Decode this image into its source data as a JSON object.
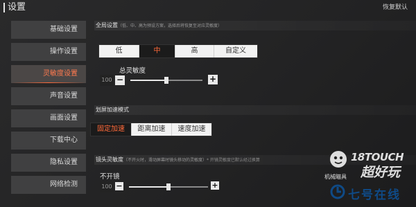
{
  "header": {
    "title": "设置",
    "restore_label": "恢复默认"
  },
  "sidebar": {
    "items": [
      {
        "label": "基础设置"
      },
      {
        "label": "操作设置"
      },
      {
        "label": "灵敏度设置"
      },
      {
        "label": "声音设置"
      },
      {
        "label": "画面设置"
      },
      {
        "label": "下载中心"
      },
      {
        "label": "隐私设置"
      },
      {
        "label": "网络检测"
      }
    ],
    "active_index": 2
  },
  "global_preset": {
    "title": "全局设置",
    "hint": "（低、中、高为预设方案，选择后将恢复至对应灵敏度）",
    "options": [
      "低",
      "中",
      "高",
      "自定义"
    ],
    "selected": "中"
  },
  "total_sensitivity": {
    "label": "总灵敏度",
    "value": "100",
    "level": 0.5,
    "minus": "−",
    "plus": "+"
  },
  "scroll_accel": {
    "title": "划屏加速模式",
    "options": [
      "固定加速",
      "距离加速",
      "速度加速"
    ],
    "selected": "固定加速"
  },
  "lens_sensitivity": {
    "title": "镜头灵敏度",
    "hint": "（不开火时，滑动屏幕时镜头移动的灵敏度）",
    "note": "* 开镜灵敏度已默认经过换算",
    "no_scope": {
      "label": "不开镜",
      "value": "100",
      "level": 0.5,
      "minus": "−",
      "plus": "+"
    },
    "right_label": "机械瞄具"
  },
  "watermark": {
    "brand": "18TOUCH",
    "brand_cn": "超好玩",
    "site": "七号在线"
  }
}
